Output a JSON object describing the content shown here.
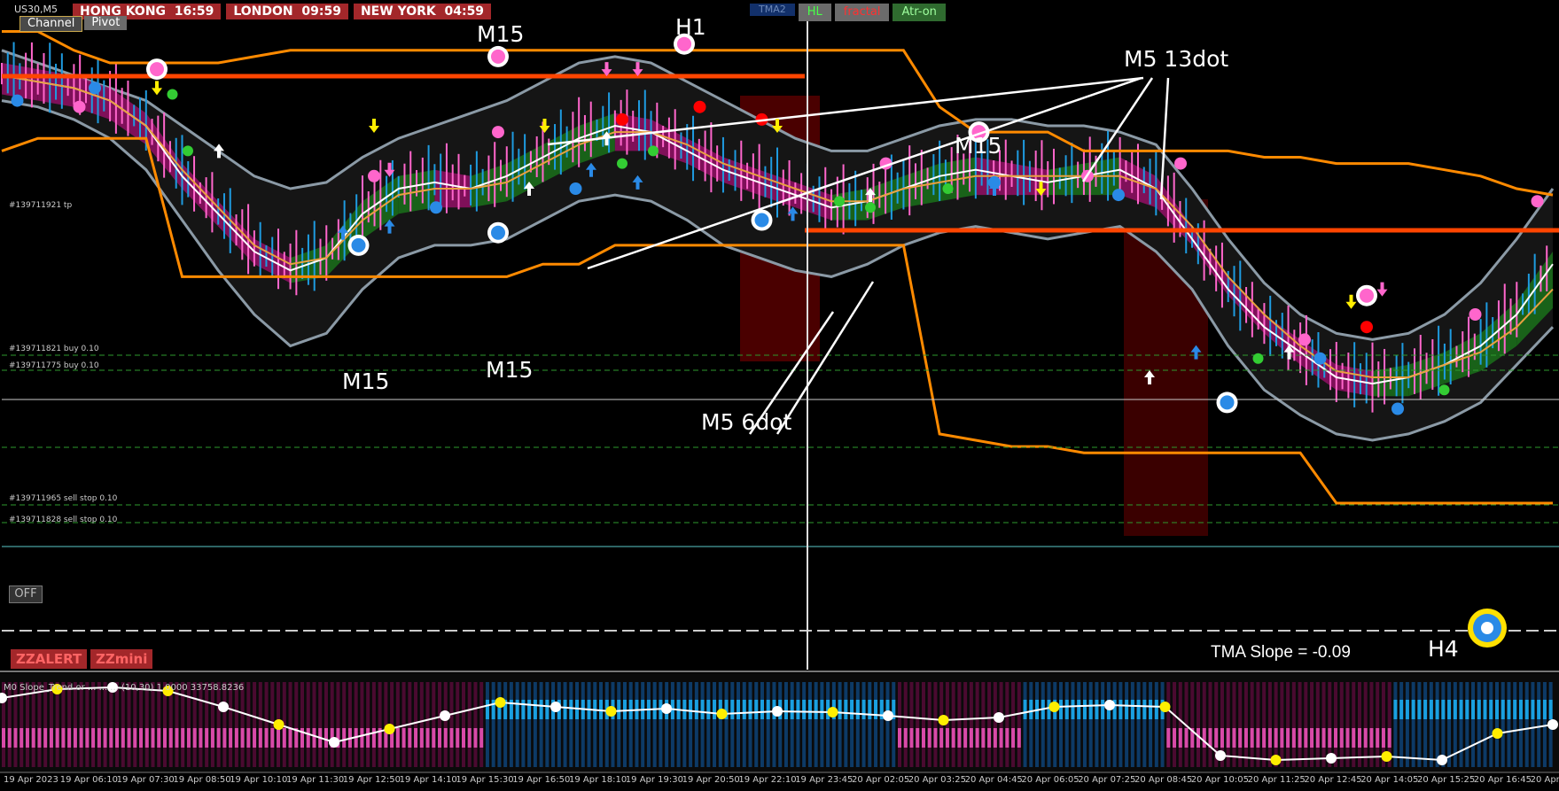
{
  "header": {
    "symbol": "US30,M5",
    "sessions": [
      {
        "city": "HONG KONG",
        "time": "16:59"
      },
      {
        "city": "LONDON",
        "time": "09:59"
      },
      {
        "city": "NEW YORK",
        "time": "04:59"
      }
    ],
    "tabs": [
      {
        "label": "Channel",
        "active": true
      },
      {
        "label": "Pivot",
        "active": false
      }
    ],
    "toggles": [
      {
        "label": "TMA2",
        "kind": "tma"
      },
      {
        "label": "HL",
        "kind": "hl"
      },
      {
        "label": "fractal",
        "kind": "fr"
      },
      {
        "label": "Atr-on",
        "kind": "atr"
      }
    ]
  },
  "buttons": {
    "off": "OFF",
    "zzalert": "ZZALERT",
    "zzmini": "ZZmini"
  },
  "orders": [
    {
      "text": "#139711921 tp",
      "y": 0.26
    },
    {
      "text": "#139711821 buy 0.10",
      "y": 0.445
    },
    {
      "text": "#139711775 buy 0.10",
      "y": 0.465
    },
    {
      "text": "#139711965 sell stop 0.10",
      "y": 0.638
    },
    {
      "text": "#139711828 sell stop 0.10",
      "y": 0.665
    }
  ],
  "annotations": {
    "m15_top": "M15",
    "h1": "H1",
    "m5_13dot": "M5 13dot",
    "m15_right": "M15",
    "m15_low1": "M15",
    "m15_low2": "M15",
    "m5_6dot": "M5 6dot",
    "h4": "H4"
  },
  "tma_slope": "TMA Slope = -0.09",
  "subwindow_label": "M0 Slope_Trend or ... ... ... (10,30) 1.0000 33758.8236",
  "colors": {
    "background": "#000000",
    "band_fill": "#151515",
    "band_edge": "#8b9aa6",
    "pivot_orange": "#ff8a00",
    "level_red": "#ff4500",
    "bear_fill": "#8b1060",
    "bull_fill": "#1a6a1a",
    "bull_candle": "#1e9be0",
    "bear_candle": "#ff66cc",
    "dark_red_zone": "#4a0000",
    "yellow_signal": "#ffee00",
    "osc_pink": "#d84aa8",
    "osc_blue": "#1aa0e0"
  },
  "chart_data": {
    "type": "line",
    "title": "",
    "xlabel": "",
    "ylabel": "",
    "x_ticks": [
      "19 Apr 2023",
      "19 Apr 06:10",
      "19 Apr 07:30",
      "19 Apr 08:50",
      "19 Apr 10:10",
      "19 Apr 11:30",
      "19 Apr 12:50",
      "19 Apr 14:10",
      "19 Apr 15:30",
      "19 Apr 16:50",
      "19 Apr 18:10",
      "19 Apr 19:30",
      "19 Apr 20:50",
      "19 Apr 22:10",
      "19 Apr 23:45",
      "20 Apr 02:05",
      "20 Apr 03:25",
      "20 Apr 04:45",
      "20 Apr 06:05",
      "20 Apr 07:25",
      "20 Apr 08:45",
      "20 Apr 10:05",
      "20 Apr 11:25",
      "20 Apr 12:45",
      "20 Apr 14:05",
      "20 Apr 15:25",
      "20 Apr 16:45",
      "20 Apr ..."
    ],
    "series": [
      {
        "values": [
          0.12,
          0.13,
          0.14,
          0.16,
          0.2,
          0.28,
          0.34,
          0.4,
          0.43,
          0.41,
          0.34,
          0.3,
          0.29,
          0.3,
          0.28,
          0.25,
          0.22,
          0.2,
          0.21,
          0.24,
          0.27,
          0.29,
          0.31,
          0.33,
          0.32,
          0.3,
          0.28,
          0.27,
          0.28,
          0.29,
          0.28,
          0.27,
          0.3,
          0.38,
          0.46,
          0.52,
          0.56,
          0.6,
          0.61,
          0.6,
          0.58,
          0.55,
          0.5,
          0.42
        ]
      },
      {
        "values": [
          0.12,
          0.13,
          0.14,
          0.16,
          0.2,
          0.27,
          0.33,
          0.39,
          0.42,
          0.41,
          0.35,
          0.31,
          0.3,
          0.3,
          0.29,
          0.26,
          0.23,
          0.21,
          0.21,
          0.23,
          0.26,
          0.28,
          0.3,
          0.32,
          0.32,
          0.3,
          0.29,
          0.28,
          0.28,
          0.28,
          0.28,
          0.28,
          0.3,
          0.36,
          0.44,
          0.5,
          0.55,
          0.59,
          0.6,
          0.6,
          0.58,
          0.56,
          0.52,
          0.46
        ]
      },
      {
        "values": [
          0.08,
          0.1,
          0.12,
          0.14,
          0.16,
          0.2,
          0.24,
          0.28,
          0.3,
          0.29,
          0.25,
          0.22,
          0.2,
          0.18,
          0.16,
          0.13,
          0.1,
          0.09,
          0.1,
          0.13,
          0.16,
          0.19,
          0.22,
          0.24,
          0.24,
          0.22,
          0.2,
          0.19,
          0.19,
          0.2,
          0.2,
          0.21,
          0.23,
          0.3,
          0.38,
          0.45,
          0.5,
          0.53,
          0.54,
          0.53,
          0.5,
          0.45,
          0.38,
          0.3
        ]
      },
      {
        "values": [
          0.16,
          0.17,
          0.19,
          0.22,
          0.27,
          0.35,
          0.43,
          0.5,
          0.55,
          0.53,
          0.46,
          0.41,
          0.39,
          0.39,
          0.38,
          0.35,
          0.32,
          0.31,
          0.32,
          0.35,
          0.39,
          0.41,
          0.43,
          0.44,
          0.42,
          0.39,
          0.37,
          0.36,
          0.37,
          0.38,
          0.37,
          0.36,
          0.4,
          0.46,
          0.55,
          0.62,
          0.66,
          0.69,
          0.7,
          0.69,
          0.67,
          0.64,
          0.58,
          0.52
        ]
      },
      {
        "values": [
          0.24,
          0.22,
          0.22,
          0.22,
          0.22,
          0.44,
          0.44,
          0.44,
          0.44,
          0.44,
          0.44,
          0.44,
          0.44,
          0.44,
          0.44,
          0.42,
          0.42,
          0.39,
          0.39,
          0.39,
          0.39,
          0.39,
          0.39,
          0.39,
          0.39,
          0.39,
          0.69,
          0.7,
          0.71,
          0.71,
          0.72,
          0.72,
          0.72,
          0.72,
          0.72,
          0.72,
          0.72,
          0.8,
          0.8,
          0.8,
          0.8,
          0.8,
          0.8,
          0.8
        ]
      },
      {
        "values": [
          0.05,
          0.05,
          0.08,
          0.1,
          0.1,
          0.1,
          0.1,
          0.09,
          0.08,
          0.08,
          0.08,
          0.08,
          0.08,
          0.08,
          0.08,
          0.08,
          0.08,
          0.08,
          0.08,
          0.08,
          0.08,
          0.08,
          0.08,
          0.08,
          0.08,
          0.08,
          0.17,
          0.21,
          0.21,
          0.21,
          0.24,
          0.24,
          0.24,
          0.24,
          0.24,
          0.25,
          0.25,
          0.26,
          0.26,
          0.26,
          0.27,
          0.28,
          0.3,
          0.31
        ]
      }
    ]
  }
}
